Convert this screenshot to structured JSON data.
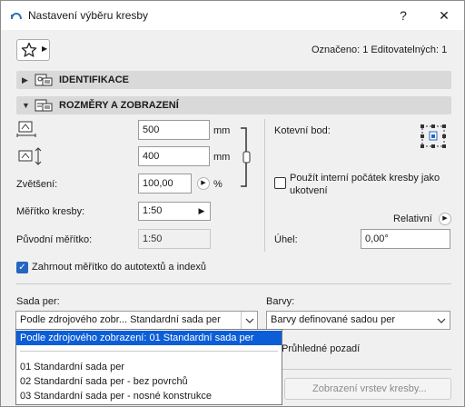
{
  "window": {
    "title": "Nastavení výběru kresby",
    "help_label": "?",
    "close_label": "✕"
  },
  "toolbar": {
    "star_icon": "star-icon",
    "selection_info": "Označeno: 1 Editovatelných: 1"
  },
  "sections": {
    "identification": "IDENTIFIKACE",
    "size_display": "ROZMĚRY A ZOBRAZENÍ"
  },
  "size": {
    "width_value": "500",
    "width_unit": "mm",
    "height_value": "400",
    "height_unit": "mm",
    "scale_label": "Zvětšení:",
    "scale_value": "100,00",
    "scale_unit": "%",
    "drawing_scale_label": "Měřítko kresby:",
    "drawing_scale_value": "1:50",
    "original_scale_label": "Původní měřítko:",
    "original_scale_value": "1:50",
    "anchor_label": "Kotevní bod:",
    "use_origin_label": "Použít interní počátek kresby jako ukotvení",
    "relative_label": "Relativní",
    "angle_label": "Úhel:",
    "angle_value": "0,00°",
    "include_scale_label": "Zahrnout měřítko do autotextů a indexů"
  },
  "pens": {
    "pen_set_label": "Sada per:",
    "pen_set_value": "Podle zdrojového zobr... Standardní sada per",
    "colors_label": "Barvy:",
    "colors_value": "Barvy definované sadou per",
    "transparent_bg_label": "Průhledné pozadí",
    "layers_button": "Zobrazení vrstev kresby..."
  },
  "dropdown": {
    "items": [
      "Podle zdrojového zobrazení: 01 Standardní sada per",
      "",
      "01 Standardní sada per",
      "02 Standardní sada per - bez povrchů",
      "03 Standardní sada per - nosné konstrukce"
    ]
  },
  "colors": {
    "accent": "#0b5ed7",
    "checkbox": "#2466c2",
    "section_bg": "#d9d9d9"
  }
}
